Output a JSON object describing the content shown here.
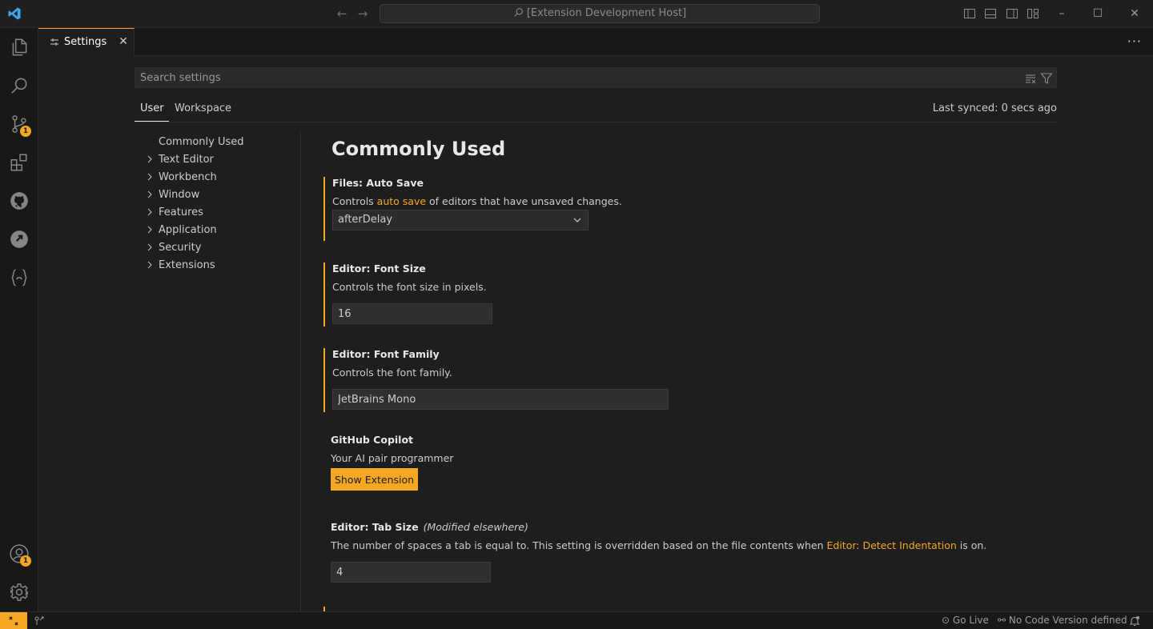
{
  "titlebar": {
    "search_text": "[Extension Development Host]"
  },
  "activity_bar": {
    "source_control_badge": "1",
    "accounts_badge": "1"
  },
  "tab": {
    "label": "Settings"
  },
  "settings": {
    "search_placeholder": "Search settings",
    "scope_tabs": [
      "User",
      "Workspace"
    ],
    "last_synced": "Last synced: 0 secs ago",
    "toc": [
      "Commonly Used",
      "Text Editor",
      "Workbench",
      "Window",
      "Features",
      "Application",
      "Security",
      "Extensions"
    ],
    "section_title": "Commonly Used",
    "items": [
      {
        "category": "Files: ",
        "key": "Auto Save",
        "desc_before": "Controls ",
        "desc_link": "auto save",
        "desc_after": " of editors that have unsaved changes.",
        "value": "afterDelay"
      },
      {
        "category": "Editor: ",
        "key": "Font Size",
        "desc": "Controls the font size in pixels.",
        "value": "16"
      },
      {
        "category": "Editor: ",
        "key": "Font Family",
        "desc": "Controls the font family.",
        "value": "JetBrains Mono"
      },
      {
        "key": "GitHub Copilot",
        "desc": "Your AI pair programmer",
        "button": "Show Extension"
      },
      {
        "category": "Editor: ",
        "key": "Tab Size",
        "modified": "(Modified elsewhere)",
        "desc_before": "The number of spaces a tab is equal to. This setting is overridden based on the file contents when ",
        "desc_link": "Editor: Detect Indentation",
        "desc_after": " is on.",
        "value": "4"
      }
    ]
  },
  "statusbar": {
    "go_live": "Go Live",
    "code_version": "No Code Version defined"
  },
  "colors": {
    "accent": "#f5a623",
    "background": "#1e1e1e",
    "sidebar": "#181818"
  }
}
